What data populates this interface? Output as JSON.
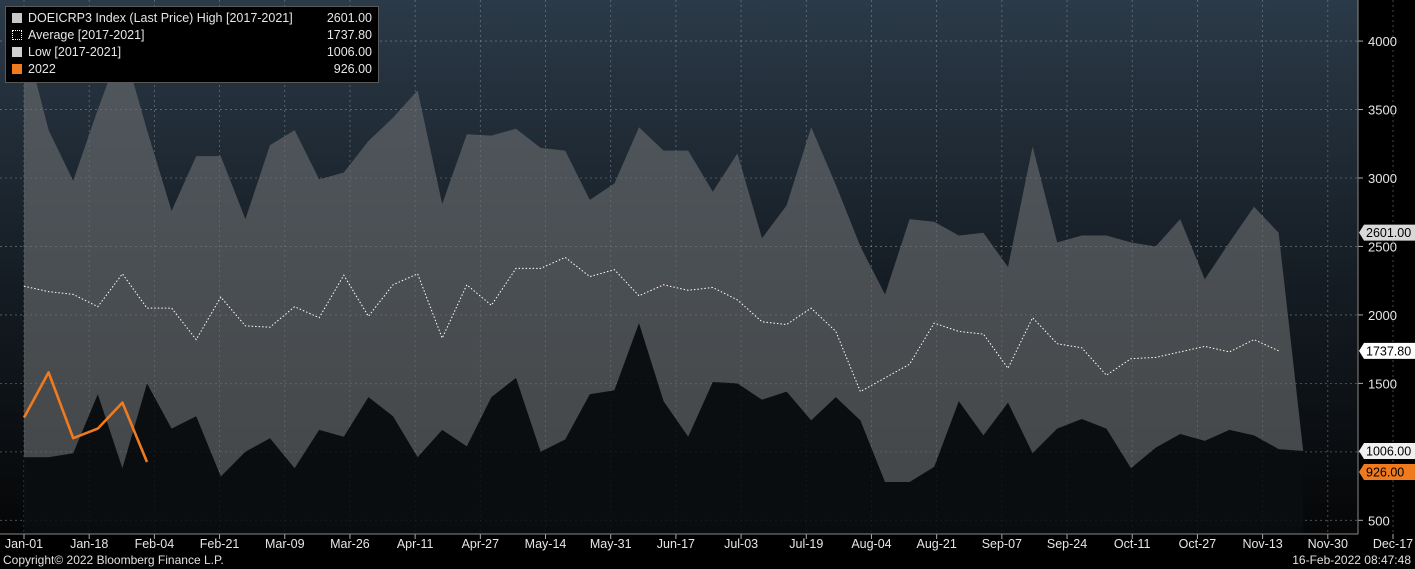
{
  "chart_data": {
    "type": "area",
    "y_ticks": [
      500,
      1000,
      1500,
      2000,
      2500,
      3000,
      3500,
      4000
    ],
    "ylim": [
      400,
      4300
    ],
    "x_ticks": [
      "Jan-01",
      "Jan-18",
      "Feb-04",
      "Feb-21",
      "Mar-09",
      "Mar-26",
      "Apr-11",
      "Apr-27",
      "May-14",
      "May-31",
      "Jun-17",
      "Jul-03",
      "Jul-19",
      "Aug-04",
      "Aug-21",
      "Sep-07",
      "Sep-24",
      "Oct-11",
      "Oct-27",
      "Nov-13",
      "Nov-30",
      "Dec-17"
    ],
    "grid": true,
    "legend_position": "top-left",
    "series": [
      {
        "name": "DOEICRP3 Index (Last Price) High [2017-2021]",
        "legend_value": "2601.00",
        "color": "#c8c8c8",
        "values": [
          4050,
          3350,
          2980,
          3500,
          3980,
          3350,
          2760,
          3160,
          3160,
          2700,
          3240,
          3350,
          2990,
          3040,
          3270,
          3440,
          3640,
          2810,
          3320,
          3310,
          3360,
          3220,
          3200,
          2840,
          2960,
          3370,
          3200,
          3200,
          2900,
          3180,
          2560,
          2800,
          3370,
          2950,
          2500,
          2150,
          2700,
          2680,
          2580,
          2600,
          2350,
          3230,
          2530,
          2580,
          2580,
          2530,
          2500,
          2700,
          2260,
          2530,
          2790,
          2601
        ]
      },
      {
        "name": "Average  [2017-2021]",
        "legend_value": "1737.80",
        "color": "#ffffff",
        "values": [
          2210,
          2170,
          2150,
          2060,
          2300,
          2050,
          2050,
          1820,
          2130,
          1920,
          1910,
          2060,
          1980,
          2290,
          1990,
          2220,
          2300,
          1830,
          2220,
          2070,
          2340,
          2340,
          2420,
          2280,
          2330,
          2140,
          2220,
          2180,
          2200,
          2110,
          1950,
          1930,
          2050,
          1880,
          1440,
          1540,
          1640,
          1940,
          1880,
          1860,
          1610,
          1980,
          1790,
          1760,
          1560,
          1680,
          1690,
          1730,
          1770,
          1730,
          1820,
          1737.8
        ]
      },
      {
        "name": "Low  [2017-2021]",
        "legend_value": "1006.00",
        "color": "#d0d0d0",
        "values": [
          960,
          960,
          990,
          1420,
          880,
          1500,
          1170,
          1260,
          820,
          1000,
          1100,
          880,
          1160,
          1110,
          1400,
          1260,
          960,
          1160,
          1040,
          1400,
          1540,
          1000,
          1090,
          1420,
          1450,
          1940,
          1370,
          1110,
          1510,
          1500,
          1380,
          1440,
          1230,
          1400,
          1230,
          780,
          780,
          890,
          1370,
          1120,
          1360,
          990,
          1170,
          1240,
          1170,
          880,
          1030,
          1130,
          1080,
          1160,
          1120,
          1020,
          1006
        ]
      },
      {
        "name": "2022",
        "legend_value": "926.00",
        "color": "#f07a1e",
        "values": [
          1250,
          1580,
          1100,
          1170,
          1360,
          926
        ]
      }
    ],
    "last_value_labels": [
      "2601.00",
      "1737.80",
      "1006.00",
      "926.00"
    ]
  },
  "footer": {
    "copyright": "Copyright© 2022 Bloomberg Finance L.P.",
    "timestamp": "16-Feb-2022 08:47:48"
  }
}
